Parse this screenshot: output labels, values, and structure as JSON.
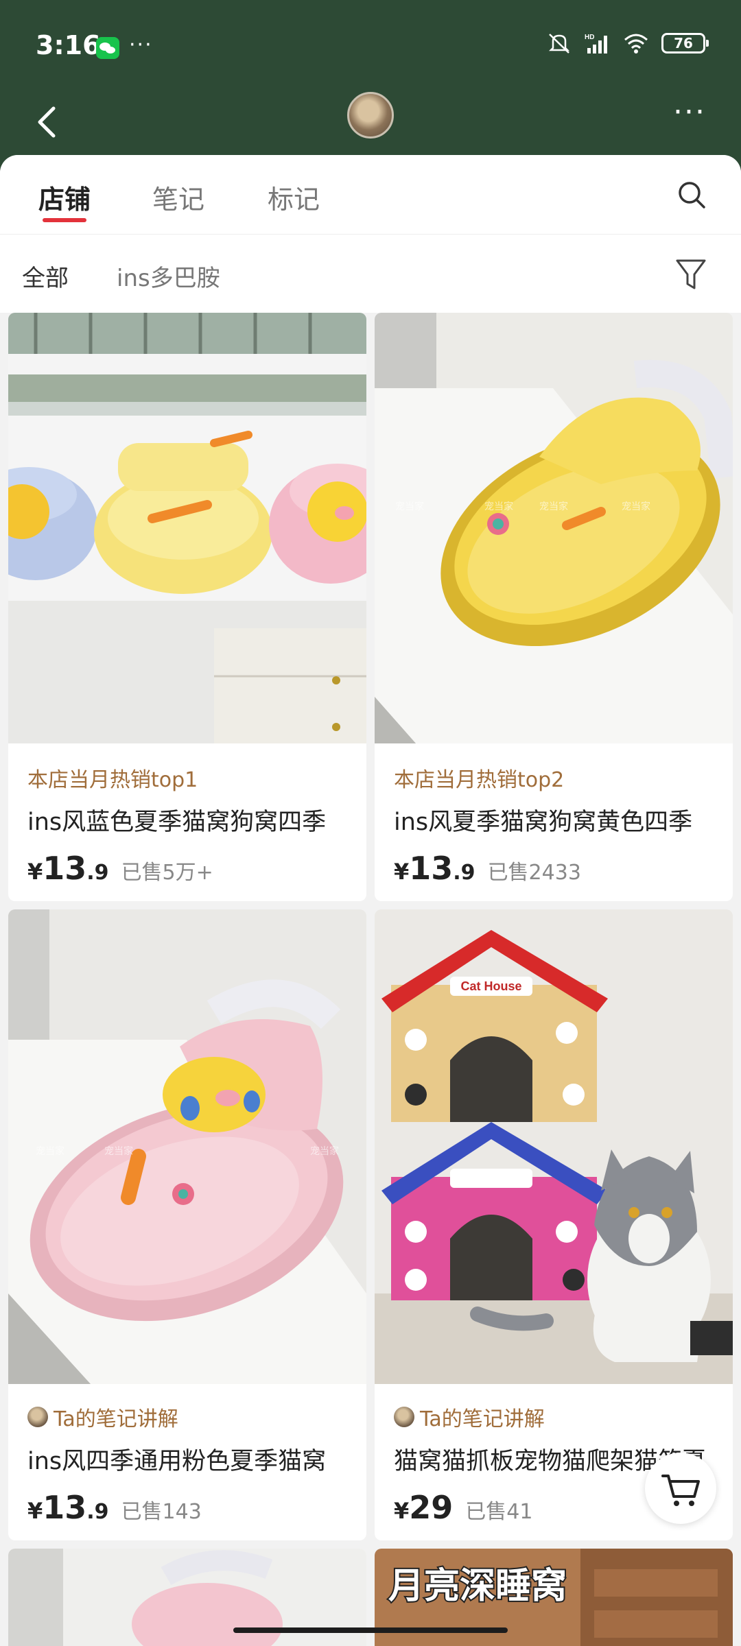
{
  "status_bar": {
    "time": "3:16",
    "more_indicator": "···",
    "battery": "76",
    "icons": [
      "wechat-icon",
      "mute-icon",
      "signal-icon",
      "wifi-icon",
      "battery-icon"
    ]
  },
  "nav": {
    "back_icon": "chevron-left-icon",
    "more_icon": "more-dots-icon",
    "more_label": "···"
  },
  "tabs": [
    {
      "label": "店铺",
      "active": true
    },
    {
      "label": "笔记",
      "active": false
    },
    {
      "label": "标记",
      "active": false
    }
  ],
  "filters": [
    {
      "label": "全部",
      "active": true
    },
    {
      "label": "ins多巴胺",
      "active": false
    }
  ],
  "products": [
    {
      "badge": "本店当月热销top1",
      "title": "ins风蓝色夏季猫窝狗窝四季",
      "price_currency": "¥",
      "price_int": "13",
      "price_dec": ".9",
      "sold": "已售5万+"
    },
    {
      "badge": "本店当月热销top2",
      "title": "ins风夏季猫窝狗窝黄色四季",
      "price_currency": "¥",
      "price_int": "13",
      "price_dec": ".9",
      "sold": "已售2433"
    },
    {
      "badge": "Ta的笔记讲解",
      "title": "ins风四季通用粉色夏季猫窝",
      "price_currency": "¥",
      "price_int": "13",
      "price_dec": ".9",
      "sold": "已售143"
    },
    {
      "badge": "Ta的笔记讲解",
      "title": "猫窝猫抓板宠物猫爬架猫笼夏",
      "price_currency": "¥",
      "price_int": "29",
      "price_dec": "",
      "sold": "已售41"
    }
  ],
  "image_text": {
    "cat_house_sign": "Cat House",
    "moon_banner": "月亮深睡窝"
  },
  "colors": {
    "header_bg": "#2d4a35",
    "active_underline": "#e3323b",
    "badge_text": "#a06d3a"
  }
}
